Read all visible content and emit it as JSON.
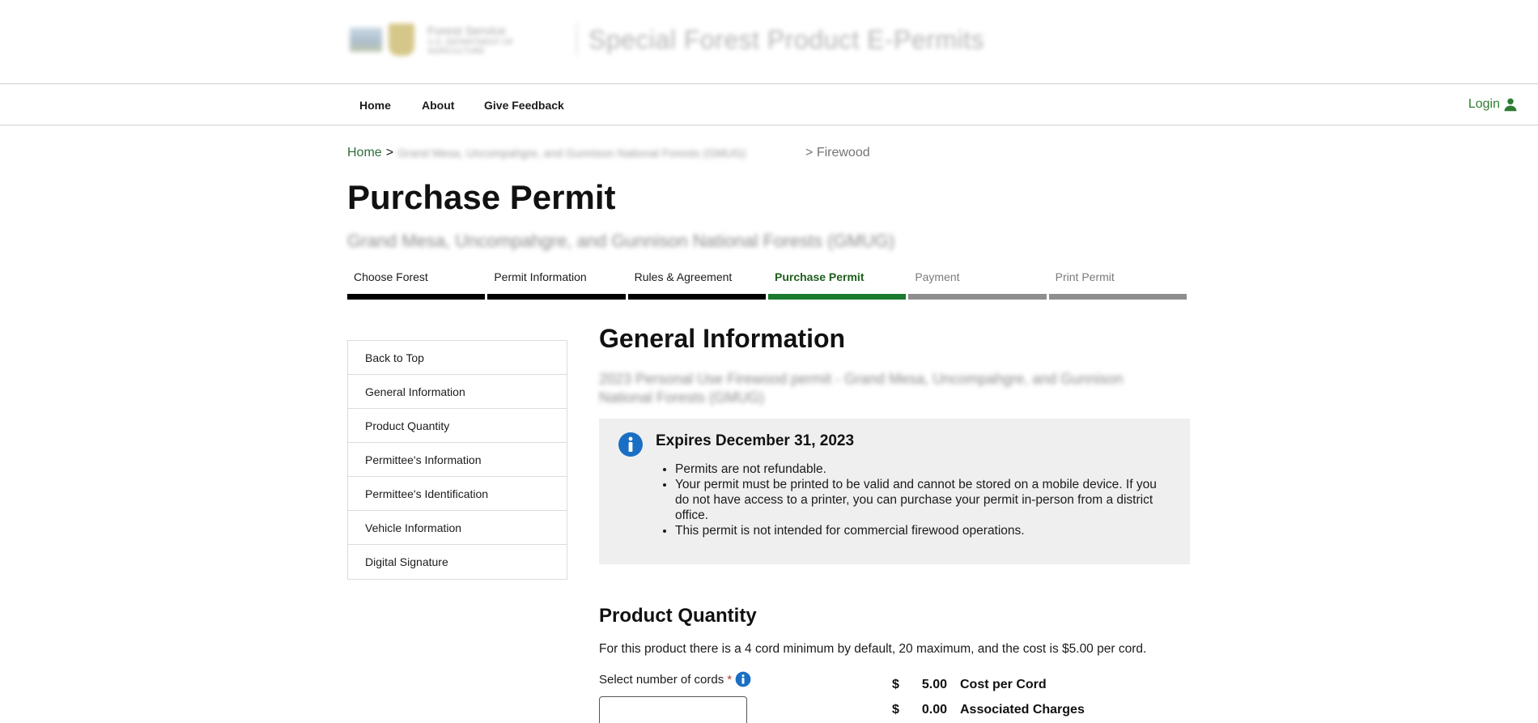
{
  "header": {
    "agency_name": "Forest Service",
    "agency_sub": "U.S. DEPARTMENT OF AGRICULTURE",
    "site_title": "Special Forest Product E-Permits"
  },
  "nav": {
    "items": [
      "Home",
      "About",
      "Give Feedback"
    ],
    "login_label": "Login"
  },
  "breadcrumb": {
    "home": "Home",
    "forest": "Grand Mesa, Uncompahgre, and Gunnison National Forests (GMUG)",
    "current": "> Firewood"
  },
  "page": {
    "title": "Purchase Permit",
    "forest_name": "Grand Mesa, Uncompahgre, and Gunnison National Forests (GMUG)"
  },
  "steps": [
    {
      "label": "Choose Forest",
      "state": "done"
    },
    {
      "label": "Permit Information",
      "state": "done"
    },
    {
      "label": "Rules & Agreement",
      "state": "done"
    },
    {
      "label": "Purchase Permit",
      "state": "active"
    },
    {
      "label": "Payment",
      "state": "future"
    },
    {
      "label": "Print Permit",
      "state": "future"
    }
  ],
  "sidemenu": {
    "items": [
      "Back to Top",
      "General Information",
      "Product Quantity",
      "Permittee's Information",
      "Permittee's Identification",
      "Vehicle Information",
      "Digital Signature"
    ]
  },
  "general_info": {
    "title": "General Information",
    "permit_name": "2023 Personal Use Firewood permit - Grand Mesa, Uncompahgre, and Gunnison National Forests (GMUG)",
    "expires": "Expires December 31, 2023",
    "bullets": [
      "Permits are not refundable.",
      "Your permit must be printed to be valid and cannot be stored on a mobile device. If you do not have access to a printer, you can purchase your permit in-person from a district office.",
      "This permit is not intended for commercial firewood operations."
    ]
  },
  "product_quantity": {
    "title": "Product Quantity",
    "description": "For this product there is a 4 cord minimum by default, 20 maximum, and the cost is $5.00 per cord.",
    "field_label": "Select number of cords",
    "required_mark": "*",
    "costs": [
      {
        "currency": "$",
        "value": "5.00",
        "label": "Cost per Cord"
      },
      {
        "currency": "$",
        "value": "0.00",
        "label": "Associated Charges"
      }
    ]
  },
  "colors": {
    "brand_green": "#2e7d32",
    "active_step": "#1a7a2e",
    "info_blue": "#1a6fc4"
  }
}
